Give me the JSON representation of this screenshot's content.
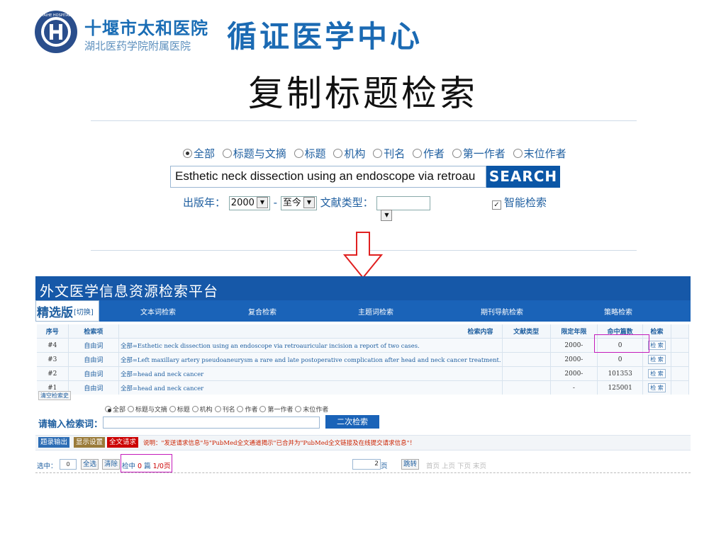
{
  "header": {
    "hospital_name": "十堰市太和医院",
    "hospital_sub": "湖北医药学院附属医院",
    "center_title": "循证医学中心",
    "logo_text": "TAIHE HOSPITAL",
    "colors": {
      "brand": "#1b6ab3"
    }
  },
  "slide_title": "复制标题检索",
  "search_panel": {
    "scope_options": [
      "全部",
      "标题与文摘",
      "标题",
      "机构",
      "刊名",
      "作者",
      "第一作者",
      "末位作者"
    ],
    "scope_selected": "全部",
    "query_value": "Esthetic neck dissection using an endoscope via retroau",
    "search_label": "SEARCH",
    "year_label": "出版年：",
    "year_from": "2000",
    "year_sep": "-",
    "year_to": "至今",
    "doc_type_label": "文献类型：",
    "doc_type_value": "",
    "smart_search_label": "智能检索",
    "smart_search_checked": true
  },
  "arrow": {
    "icon": "down-arrow-icon",
    "color": "#e02020"
  },
  "db": {
    "title": "外文医学信息资源检索平台",
    "edition_label": "精选版",
    "edition_switch": "[切换]",
    "nav_tabs": [
      "文本词检索",
      "复合检索",
      "主题词检索",
      "期刊导航检索",
      "策略检索"
    ],
    "table_headers": [
      "序号",
      "检索项",
      "检索内容",
      "文献类型",
      "限定年限",
      "命中篇数",
      "检索"
    ],
    "rows": [
      {
        "id": "#4",
        "field": "自由词",
        "content": "全部=Esthetic neck dissection using an endoscope via retroauricular incision a report of two cases.",
        "doc_type": "",
        "year": "2000-",
        "hits": "0",
        "action": "检 索"
      },
      {
        "id": "#3",
        "field": "自由词",
        "content": "全部=Left maxillary artery pseudoaneurysm a rare and late postoperative complication after head and neck cancer treatment.",
        "doc_type": "",
        "year": "2000-",
        "hits": "0",
        "action": "检 索"
      },
      {
        "id": "#2",
        "field": "自由词",
        "content": "全部=head and neck cancer",
        "doc_type": "",
        "year": "2000-",
        "hits": "101353",
        "action": "检 索"
      },
      {
        "id": "#1",
        "field": "自由词",
        "content": "全部=head and neck cancer",
        "doc_type": "",
        "year": "-",
        "hits": "125001",
        "action": "检 索"
      }
    ],
    "clear_history": "清空检索史",
    "scope_options": [
      "全部",
      "标题与文摘",
      "标题",
      "机构",
      "刊名",
      "作者",
      "第一作者",
      "末位作者"
    ],
    "input_label": "请输入检索词：",
    "input_value": "",
    "second_search": "二次检索",
    "actions": [
      "题录输出",
      "显示设置",
      "全文请求"
    ],
    "note": "说明：\"发送请求信息\"与\"PubMed全文通道揭示\"已合并为\"PubMed全文链接及在线提交请求信息\"！",
    "select_label": "选中：",
    "select_count": "0",
    "select_all": "全选",
    "clear": "清除",
    "hits_prefix": "检中",
    "hits_count": "0",
    "hits_mid": "篇",
    "hits_pages": "1/0页",
    "page_input": "2",
    "page_suffix": "页",
    "jump": "跳转",
    "pager": "首页 上页 下页 末页",
    "colors": {
      "header": "#1658a8",
      "nav": "#1a63b8",
      "highlight": "#c41bbb"
    }
  }
}
